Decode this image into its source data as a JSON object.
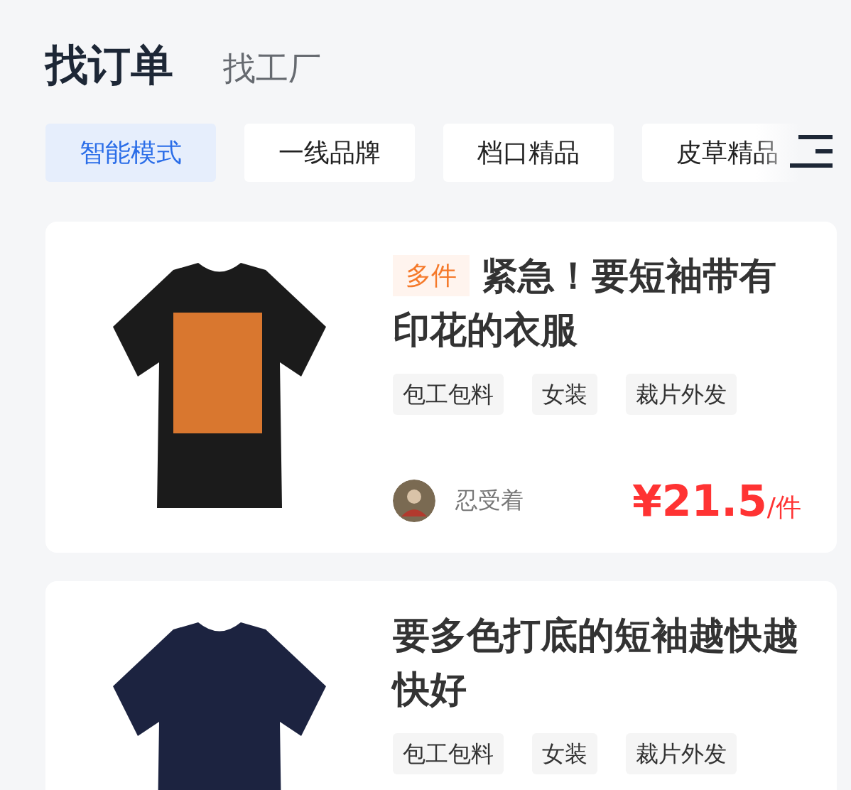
{
  "main_tabs": [
    {
      "label": "找订单",
      "selected": true
    },
    {
      "label": "找工厂",
      "selected": false
    }
  ],
  "filter_chips": [
    {
      "label": "智能模式",
      "selected": true
    },
    {
      "label": "一线品牌",
      "selected": false
    },
    {
      "label": "档口精品",
      "selected": false
    },
    {
      "label": "皮草精品",
      "selected": false
    }
  ],
  "orders": [
    {
      "badge": "多件",
      "title": "紧急！要短袖带有印花的衣服",
      "tags": [
        "包工包料",
        "女装",
        "裁片外发"
      ],
      "poster": "忍受着",
      "price": "¥21.5",
      "unit": "/件"
    },
    {
      "title": "要多色打底的短袖越快越快好",
      "tags": [
        "包工包料",
        "女装",
        "裁片外发"
      ]
    }
  ]
}
